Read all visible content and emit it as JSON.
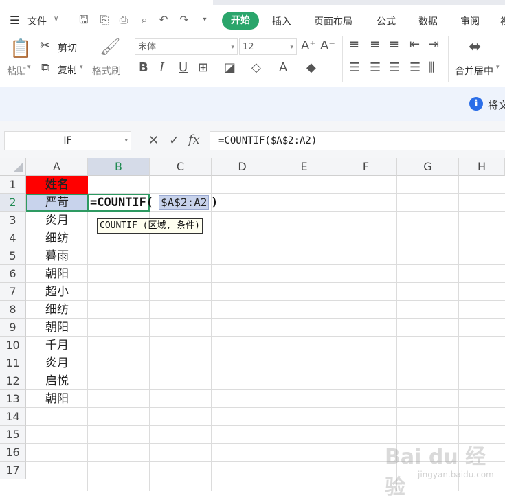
{
  "menubar": {
    "file_label": "文件",
    "tabs": [
      {
        "label": "开始",
        "active": true
      },
      {
        "label": "插入"
      },
      {
        "label": "页面布局"
      },
      {
        "label": "公式"
      },
      {
        "label": "数据"
      },
      {
        "label": "审阅"
      },
      {
        "label": "视"
      }
    ],
    "accent_color": "#2aa56b"
  },
  "ribbon": {
    "paste_label": "粘贴",
    "cut_label": "剪切",
    "copy_label": "复制",
    "format_painter_label": "格式刷",
    "font_name": "宋体",
    "font_size": "12",
    "merge_label": "合并居中"
  },
  "notice": {
    "text": "将文"
  },
  "formula_bar": {
    "name_box": "IF",
    "fx_label": "fx",
    "formula": "=COUNTIF($A$2:A2)"
  },
  "sheet": {
    "columns": [
      "A",
      "B",
      "C",
      "D",
      "E",
      "F",
      "G",
      "H"
    ],
    "selected_column": "B",
    "rows": [
      "1",
      "2",
      "3",
      "4",
      "5",
      "6",
      "7",
      "8",
      "9",
      "10",
      "11",
      "12",
      "13",
      "14",
      "15",
      "16",
      "17"
    ],
    "selected_row": "2",
    "header_cell": "姓名",
    "names": [
      "严苛",
      "炎月",
      "细纺",
      "暮雨",
      "朝阳",
      "超小",
      "细纺",
      "朝阳",
      "千月",
      "炎月",
      "启悦",
      "朝阳"
    ],
    "editing": {
      "prefix": "=COUNTIF(",
      "range": "$A$2:A2",
      "suffix": ")"
    },
    "tooltip": "COUNTIF (区域, 条件)",
    "header_color": "#ff0000"
  },
  "watermark": {
    "text": "Bai du 经验",
    "sub": "jingyan.baidu.com"
  }
}
